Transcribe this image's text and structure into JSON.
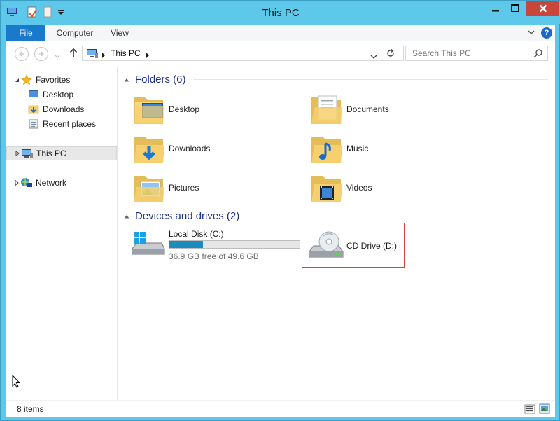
{
  "window": {
    "title": "This PC"
  },
  "ribbon": {
    "tabs": [
      {
        "label": "File"
      },
      {
        "label": "Computer"
      },
      {
        "label": "View"
      }
    ],
    "help": "?"
  },
  "address": {
    "crumb": "This PC",
    "search_placeholder": "Search This PC"
  },
  "navpane": {
    "favorites": {
      "label": "Favorites",
      "items": [
        {
          "label": "Desktop"
        },
        {
          "label": "Downloads"
        },
        {
          "label": "Recent places"
        }
      ]
    },
    "thispc": {
      "label": "This PC"
    },
    "network": {
      "label": "Network"
    }
  },
  "groups": {
    "folders": {
      "title": "Folders (6)",
      "items": [
        {
          "label": "Desktop"
        },
        {
          "label": "Documents"
        },
        {
          "label": "Downloads"
        },
        {
          "label": "Music"
        },
        {
          "label": "Pictures"
        },
        {
          "label": "Videos"
        }
      ]
    },
    "drives": {
      "title": "Devices and drives (2)",
      "items": [
        {
          "label": "Local Disk (C:)",
          "free_text": "36.9 GB free of 49.6 GB",
          "used_fraction": 0.256
        },
        {
          "label": "CD Drive (D:)"
        }
      ]
    }
  },
  "status": {
    "count": "8 items"
  },
  "colors": {
    "window_frame": "#5ec8ea",
    "file_tab": "#1979ca",
    "close_button": "#c9463d",
    "group_title": "#1e3287",
    "selection_border": "#d9433d",
    "drive_bar": "#1c8bbf"
  }
}
